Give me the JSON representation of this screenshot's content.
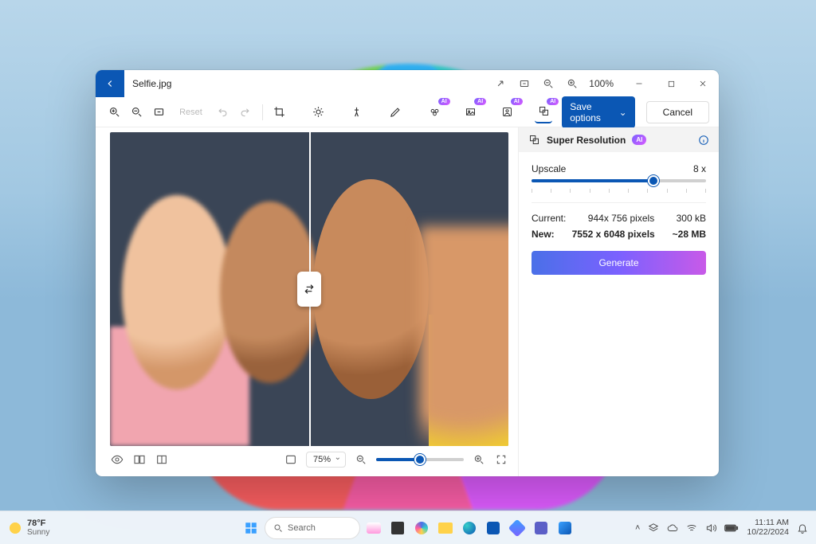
{
  "window": {
    "filename": "Selfie.jpg",
    "zoom_label": "100%"
  },
  "toolbar": {
    "reset": "Reset",
    "ai_badge": "AI",
    "save": "Save options",
    "cancel": "Cancel"
  },
  "panel": {
    "title": "Super Resolution",
    "ai_badge": "AI",
    "upscale_label": "Upscale",
    "upscale_value": "8 x",
    "slider_percent": 70,
    "current_label": "Current:",
    "current_dims": "944x 756 pixels",
    "current_size": "300 kB",
    "new_label": "New:",
    "new_dims": "7552 x 6048 pixels",
    "new_size": "~28 MB",
    "generate": "Generate"
  },
  "footer": {
    "zoom_select": "75%",
    "slider_percent": 50
  },
  "taskbar": {
    "temp": "78°F",
    "cond": "Sunny",
    "search": "Search",
    "time": "11:11 AM",
    "date": "10/22/2024"
  }
}
